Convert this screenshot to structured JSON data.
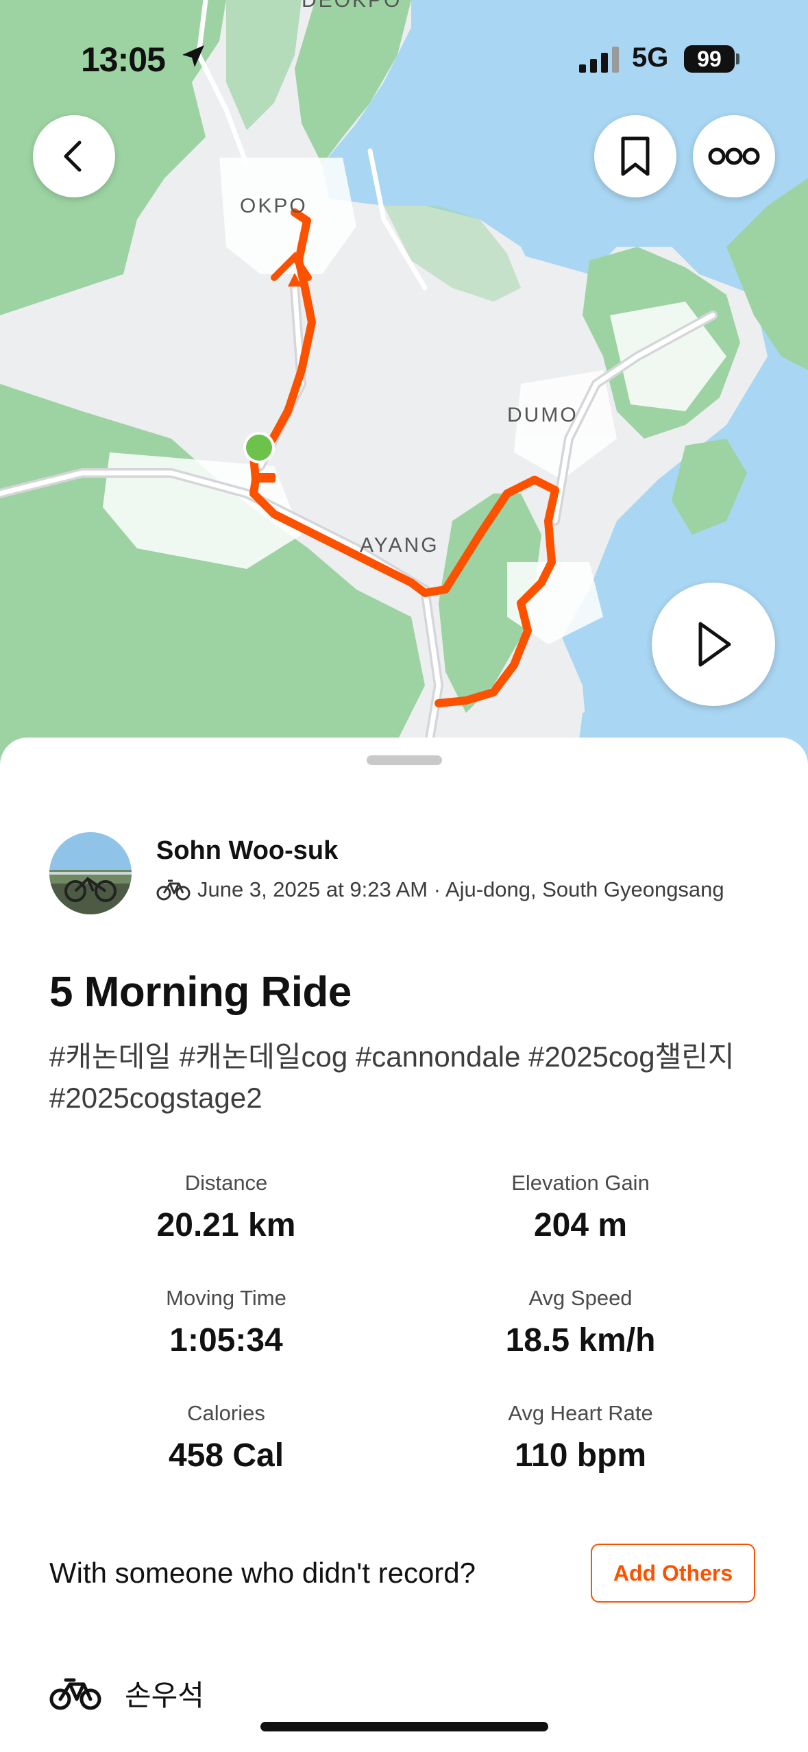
{
  "status_bar": {
    "time": "13:05",
    "network": "5G",
    "battery": "99"
  },
  "map": {
    "labels": {
      "deokpo": "DEOKPO",
      "okpo": "OKPO",
      "dumo": "DUMO",
      "ayang": "AYANG"
    },
    "route_color": "#fc5200",
    "start_marker_color": "#6cc24a"
  },
  "toolbar": {
    "back": "back",
    "save": "bookmark",
    "more": "more"
  },
  "activity": {
    "athlete": "Sohn Woo-suk",
    "meta": "June 3, 2025 at 9:23 AM · Aju-dong, South Gyeongsang",
    "title": "5 Morning Ride",
    "description": "#캐논데일 #캐논데일cog #cannondale #2025cog챌린지 #2025cogstage2"
  },
  "stats": [
    {
      "label": "Distance",
      "value": "20.21 km"
    },
    {
      "label": "Elevation Gain",
      "value": "204 m"
    },
    {
      "label": "Moving Time",
      "value": "1:05:34"
    },
    {
      "label": "Avg Speed",
      "value": "18.5 km/h"
    },
    {
      "label": "Calories",
      "value": "458 Cal"
    },
    {
      "label": "Avg Heart Rate",
      "value": "110 bpm"
    }
  ],
  "with_others": {
    "prompt": "With someone who didn't record?",
    "button": "Add Others"
  },
  "bike": {
    "name": "손우석"
  },
  "colors": {
    "accent": "#fc5200",
    "water": "#a9d6f2",
    "land": "#eceef0",
    "forest": "#9dd3a3"
  }
}
